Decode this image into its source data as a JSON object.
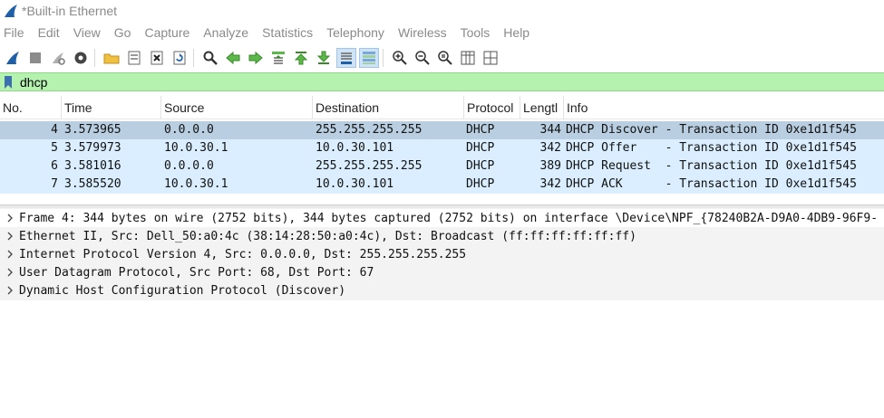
{
  "window": {
    "title": "*Built-in Ethernet"
  },
  "menu": [
    "File",
    "Edit",
    "View",
    "Go",
    "Capture",
    "Analyze",
    "Statistics",
    "Telephony",
    "Wireless",
    "Tools",
    "Help"
  ],
  "filter": {
    "value": "dhcp"
  },
  "columns": [
    "No.",
    "Time",
    "Source",
    "Destination",
    "Protocol",
    "Lengtl",
    "Info"
  ],
  "packets": [
    {
      "no": "4",
      "time": "3.573965",
      "source": "0.0.0.0",
      "destination": "255.255.255.255",
      "protocol": "DHCP",
      "length": "344",
      "info": "DHCP Discover - Transaction ID 0xe1d1f545"
    },
    {
      "no": "5",
      "time": "3.579973",
      "source": "10.0.30.1",
      "destination": "10.0.30.101",
      "protocol": "DHCP",
      "length": "342",
      "info": "DHCP Offer    - Transaction ID 0xe1d1f545"
    },
    {
      "no": "6",
      "time": "3.581016",
      "source": "0.0.0.0",
      "destination": "255.255.255.255",
      "protocol": "DHCP",
      "length": "389",
      "info": "DHCP Request  - Transaction ID 0xe1d1f545"
    },
    {
      "no": "7",
      "time": "3.585520",
      "source": "10.0.30.1",
      "destination": "10.0.30.101",
      "protocol": "DHCP",
      "length": "342",
      "info": "DHCP ACK      - Transaction ID 0xe1d1f545"
    }
  ],
  "details": [
    "Frame 4: 344 bytes on wire (2752 bits), 344 bytes captured (2752 bits) on interface \\Device\\NPF_{78240B2A-D9A0-4DB9-96F9-",
    "Ethernet II, Src: Dell_50:a0:4c (38:14:28:50:a0:4c), Dst: Broadcast (ff:ff:ff:ff:ff:ff)",
    "Internet Protocol Version 4, Src: 0.0.0.0, Dst: 255.255.255.255",
    "User Datagram Protocol, Src Port: 68, Dst Port: 67",
    "Dynamic Host Configuration Protocol (Discover)"
  ],
  "colors": {
    "filter_bg": "#b5f2b0",
    "selected_row": "#b9cee0",
    "row_bg": "#daeeff",
    "accent": "#1f5fa8"
  }
}
